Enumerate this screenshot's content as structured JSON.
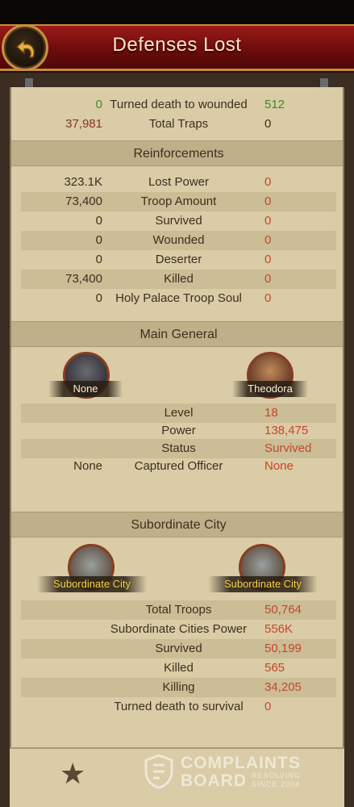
{
  "header": {
    "title": "Defenses Lost"
  },
  "top_rows": [
    {
      "left": "0",
      "label": "Turned death to wounded",
      "right": "512"
    },
    {
      "left": "37,981",
      "label": "Total Traps",
      "right": "0"
    }
  ],
  "reinforcements": {
    "title": "Reinforcements",
    "rows": [
      {
        "left": "323.1K",
        "label": "Lost Power",
        "right": "0"
      },
      {
        "left": "73,400",
        "label": "Troop Amount",
        "right": "0"
      },
      {
        "left": "0",
        "label": "Survived",
        "right": "0"
      },
      {
        "left": "0",
        "label": "Wounded",
        "right": "0"
      },
      {
        "left": "0",
        "label": "Deserter",
        "right": "0"
      },
      {
        "left": "73,400",
        "label": "Killed",
        "right": "0"
      },
      {
        "left": "0",
        "label": "Holy Palace Troop Soul",
        "right": "0"
      }
    ]
  },
  "main_general": {
    "title": "Main General",
    "left_name": "None",
    "right_name": "Theodora",
    "rows": [
      {
        "left": "",
        "label": "Level",
        "right": "18"
      },
      {
        "left": "",
        "label": "Power",
        "right": "138,475"
      },
      {
        "left": "",
        "label": "Status",
        "right": "Survived"
      },
      {
        "left": "None",
        "label": "Captured Officer",
        "right": "None"
      }
    ]
  },
  "subordinate_city": {
    "title": "Subordinate City",
    "left_name": "Subordinate City",
    "right_name": "Subordinate City",
    "rows": [
      {
        "left": "",
        "label": "Total Troops",
        "right": "50,764"
      },
      {
        "left": "",
        "label": "Subordinate Cities Power",
        "right": "556K"
      },
      {
        "left": "",
        "label": "Survived",
        "right": "50,199"
      },
      {
        "left": "",
        "label": "Killed",
        "right": "565"
      },
      {
        "left": "",
        "label": "Killing",
        "right": "34,205"
      },
      {
        "left": "",
        "label": "Turned death to survival",
        "right": "0"
      }
    ]
  },
  "watermark": {
    "line1": "COMPLAINTS",
    "line2": "BOARD",
    "tag1": "RESOLVING",
    "tag2": "SINCE 2004"
  },
  "icons": {
    "back": "back-arrow-icon",
    "favorite": "star-icon"
  },
  "colors": {
    "banner": "#7a1110",
    "panel": "#d9cca6",
    "value_red": "#c6462c",
    "value_green": "#3f8a2e"
  }
}
